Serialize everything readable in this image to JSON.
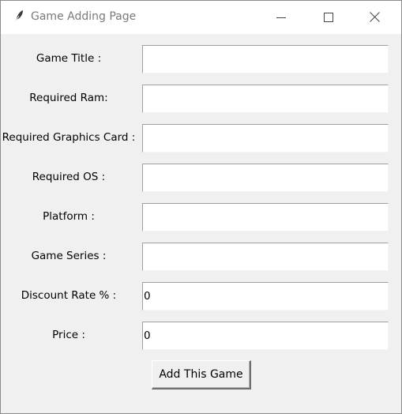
{
  "window": {
    "title": "Game Adding Page",
    "icon": "feather-icon",
    "controls": [
      "minimize-icon",
      "maximize-icon",
      "close-icon"
    ]
  },
  "form": {
    "fields": [
      {
        "label": "Game Title :",
        "value": ""
      },
      {
        "label": "Required Ram:",
        "value": ""
      },
      {
        "label": "Required Graphics Card :",
        "value": ""
      },
      {
        "label": "Required OS :",
        "value": ""
      },
      {
        "label": "Platform :",
        "value": ""
      },
      {
        "label": "Game Series :",
        "value": ""
      },
      {
        "label": "Discount Rate % :",
        "value": "0"
      },
      {
        "label": "Price :",
        "value": "0"
      }
    ],
    "submit_label": "Add This Game"
  }
}
